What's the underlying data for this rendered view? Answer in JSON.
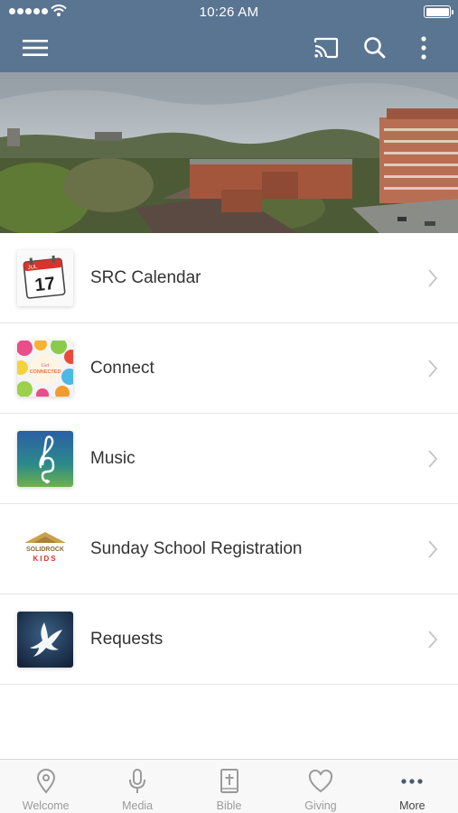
{
  "status_bar": {
    "time": "10:26 AM"
  },
  "nav": {
    "menu_icon": "hamburger-menu-icon",
    "cast_icon": "cast-icon",
    "search_icon": "search-icon",
    "more_icon": "vertical-dots-icon"
  },
  "hero": {
    "description_icon": "city-skyline-photo"
  },
  "list": [
    {
      "label": "SRC Calendar",
      "icon": "calendar-icon",
      "calendar_day": "17",
      "calendar_month": "JUL"
    },
    {
      "label": "Connect",
      "icon": "get-connected-icon",
      "thumb_text": "Get CONNECTED"
    },
    {
      "label": "Music",
      "icon": "treble-clef-icon"
    },
    {
      "label": "Sunday School Registration",
      "icon": "solidrock-kids-logo",
      "logo_line1": "SOLIDROCK",
      "logo_line2": "KIDS"
    },
    {
      "label": "Requests",
      "icon": "dove-icon"
    }
  ],
  "tabs": [
    {
      "label": "Welcome",
      "icon": "location-pin-icon",
      "active": false
    },
    {
      "label": "Media",
      "icon": "microphone-icon",
      "active": false
    },
    {
      "label": "Bible",
      "icon": "bible-icon",
      "active": false
    },
    {
      "label": "Giving",
      "icon": "heart-icon",
      "active": false
    },
    {
      "label": "More",
      "icon": "horizontal-dots-icon",
      "active": true
    }
  ],
  "colors": {
    "navbar": "#5a7591",
    "tab_active": "#444444",
    "tab_inactive": "#9a9a9a"
  }
}
